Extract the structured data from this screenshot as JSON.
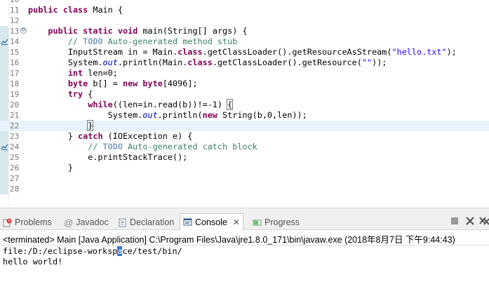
{
  "editor": {
    "lines": [
      {
        "num": "10",
        "segments": []
      },
      {
        "num": "11",
        "segments": [
          [
            "kw",
            "public"
          ],
          [
            "t",
            " "
          ],
          [
            "kw",
            "class"
          ],
          [
            "t",
            " Main {"
          ]
        ]
      },
      {
        "num": "12",
        "segments": []
      },
      {
        "num": "13",
        "fold": "⊖",
        "segments": [
          [
            "t",
            "    "
          ],
          [
            "kw",
            "public"
          ],
          [
            "t",
            " "
          ],
          [
            "kw",
            "static"
          ],
          [
            "t",
            " "
          ],
          [
            "kw",
            "void"
          ],
          [
            "t",
            " main(String[] args) {"
          ]
        ]
      },
      {
        "num": "14",
        "marker": true,
        "segments": [
          [
            "t",
            "        "
          ],
          [
            "cm",
            "// "
          ],
          [
            "task",
            "TODO"
          ],
          [
            "cm",
            " Auto-generated method stub"
          ]
        ]
      },
      {
        "num": "15",
        "segments": [
          [
            "t",
            "        InputStream in = Main."
          ],
          [
            "kw",
            "class"
          ],
          [
            "t",
            ".getClassLoader().getResourceAsStream("
          ],
          [
            "str",
            "\"hello.txt\""
          ],
          [
            "t",
            ");"
          ]
        ]
      },
      {
        "num": "16",
        "segments": [
          [
            "t",
            "        System."
          ],
          [
            "fld",
            "out"
          ],
          [
            "t",
            ".println(Main."
          ],
          [
            "kw",
            "class"
          ],
          [
            "t",
            ".getClassLoader().getResource("
          ],
          [
            "str",
            "\"\""
          ],
          [
            "t",
            "));"
          ]
        ]
      },
      {
        "num": "17",
        "segments": [
          [
            "t",
            "        "
          ],
          [
            "kw",
            "int"
          ],
          [
            "t",
            " len=0;"
          ]
        ]
      },
      {
        "num": "18",
        "segments": [
          [
            "t",
            "        "
          ],
          [
            "kw",
            "byte"
          ],
          [
            "t",
            " b[] = "
          ],
          [
            "kw",
            "new"
          ],
          [
            "t",
            " "
          ],
          [
            "kw",
            "byte"
          ],
          [
            "t",
            "[4096];"
          ]
        ]
      },
      {
        "num": "19",
        "segments": [
          [
            "t",
            "        "
          ],
          [
            "kw",
            "try"
          ],
          [
            "t",
            " {"
          ]
        ]
      },
      {
        "num": "20",
        "segments": [
          [
            "t",
            "            "
          ],
          [
            "kw",
            "while"
          ],
          [
            "t",
            "((len=in.read(b))!=-1) "
          ],
          [
            "brk",
            "{"
          ]
        ]
      },
      {
        "num": "21",
        "segments": [
          [
            "t",
            "                System."
          ],
          [
            "fld",
            "out"
          ],
          [
            "t",
            ".println("
          ],
          [
            "kw",
            "new"
          ],
          [
            "t",
            " String(b,0,len));"
          ]
        ]
      },
      {
        "num": "22",
        "current": true,
        "segments": [
          [
            "t",
            "            "
          ],
          [
            "brk",
            "}"
          ]
        ]
      },
      {
        "num": "23",
        "segments": [
          [
            "t",
            "        } "
          ],
          [
            "kw",
            "catch"
          ],
          [
            "t",
            " (IOException e) {"
          ]
        ]
      },
      {
        "num": "24",
        "marker": true,
        "segments": [
          [
            "t",
            "            "
          ],
          [
            "cm",
            "// "
          ],
          [
            "task",
            "TODO"
          ],
          [
            "cm",
            " Auto-generated catch block"
          ]
        ]
      },
      {
        "num": "25",
        "segments": [
          [
            "t",
            "            e.printStackTrace();"
          ]
        ]
      },
      {
        "num": "26",
        "segments": [
          [
            "t",
            "        }"
          ]
        ]
      },
      {
        "num": "27",
        "segments": []
      },
      {
        "num": "28",
        "segments": []
      }
    ]
  },
  "panel": {
    "tabs": [
      {
        "label": "Problems",
        "icon": "problems-icon",
        "active": false
      },
      {
        "label": "Javadoc",
        "icon": "at-icon",
        "active": false
      },
      {
        "label": "Declaration",
        "icon": "declaration-icon",
        "active": false
      },
      {
        "label": "Console",
        "icon": "console-icon",
        "active": true,
        "close": "✕"
      },
      {
        "label": "Progress",
        "icon": "progress-icon",
        "active": false
      }
    ],
    "process_label": "<terminated> Main [Java Application] C:\\Program Files\\Java\\jre1.8.0_171\\bin\\javaw.exe (2018年8月7日 下午9:44:43)",
    "output": {
      "line1_before": "file:/D:/eclipse-worksp",
      "line1_caret": "a",
      "line1_after": "ce/test/bin/",
      "line2": "hello world!"
    }
  },
  "colors": {
    "keyword": "#7f0055",
    "comment": "#3f7f5f",
    "string": "#2a00ff",
    "field": "#0000c0",
    "current_line": "#e8f2fe"
  }
}
